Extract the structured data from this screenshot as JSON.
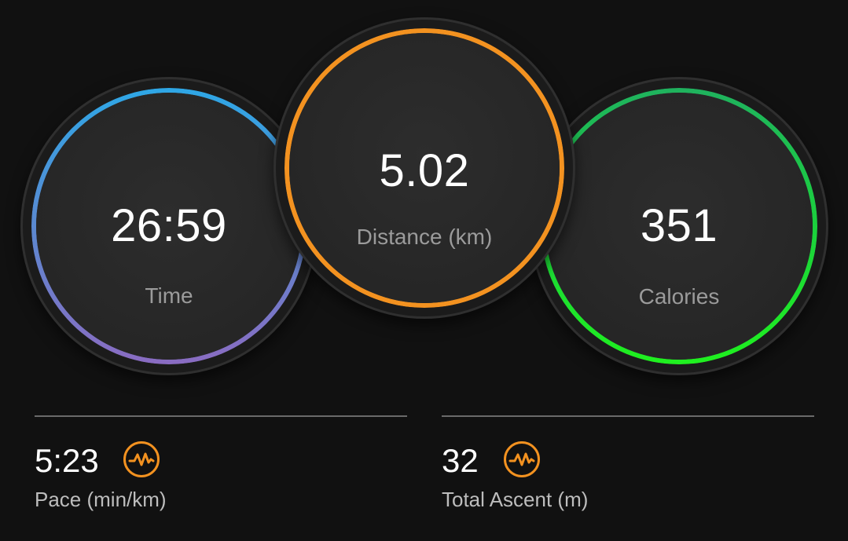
{
  "rings": {
    "time": {
      "value": "26:59",
      "label": "Time",
      "colors": [
        "#2ea7e6",
        "#8a6cc2"
      ]
    },
    "distance": {
      "value": "5.02",
      "label": "Distance (km)",
      "color": "#f39220"
    },
    "calories": {
      "value": "351",
      "label": "Calories",
      "colors": [
        "#1fb25e",
        "#1ff01f"
      ]
    }
  },
  "stats": {
    "pace": {
      "value": "5:23",
      "label": "Pace (min/km)",
      "icon": "heart-rate-activity-icon"
    },
    "ascent": {
      "value": "32",
      "label": "Total Ascent (m)",
      "icon": "heart-rate-activity-icon"
    }
  },
  "accent": "#f39220"
}
